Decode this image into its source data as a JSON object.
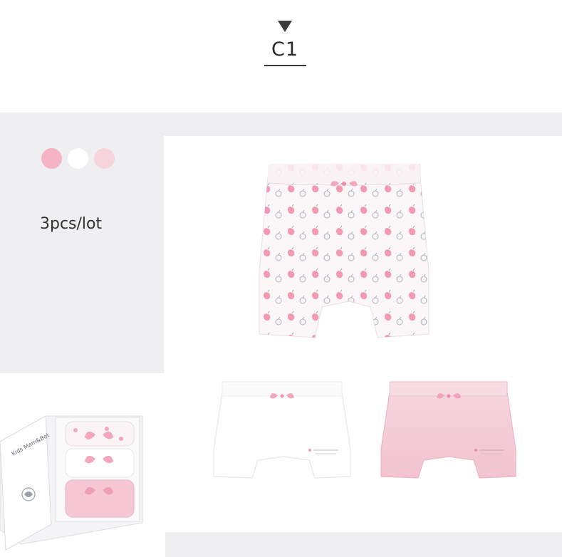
{
  "header": {
    "title": "C1",
    "arrow_icon": "triangle-down-icon"
  },
  "options": {
    "swatches": [
      {
        "name": "pink-swatch",
        "color": "#f6b3c4"
      },
      {
        "name": "white-swatch",
        "color": "#ffffff"
      },
      {
        "name": "light-pink-swatch",
        "color": "#f6d4dc"
      }
    ],
    "pack_label": "3pcs/lot"
  },
  "products": {
    "main_item": "patterned-briefs-image",
    "items": [
      "white-briefs-image",
      "pink-briefs-image"
    ]
  },
  "gift_box": {
    "brand_text": "Kids Mam&Bet"
  },
  "colors": {
    "panel_bg": "#efeff1",
    "card_bg": "#ffffff",
    "pink": "#f5a9bd",
    "light_pink": "#f7d3dc"
  }
}
